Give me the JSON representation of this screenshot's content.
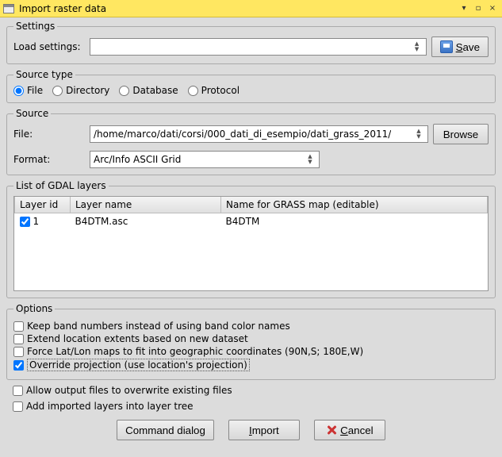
{
  "window": {
    "title": "Import raster data"
  },
  "settings": {
    "legend": "Settings",
    "load_label": "Load settings:",
    "save_label": "Save"
  },
  "source_type": {
    "legend": "Source type",
    "options": [
      "File",
      "Directory",
      "Database",
      "Protocol"
    ],
    "selected": "File"
  },
  "source": {
    "legend": "Source",
    "file_label": "File:",
    "file_value": "/home/marco/dati/corsi/000_dati_di_esempio/dati_grass_2011/",
    "browse_label": "Browse",
    "format_label": "Format:",
    "format_value": "Arc/Info ASCII Grid"
  },
  "layers": {
    "legend": "List of GDAL layers",
    "columns": [
      "Layer id",
      "Layer name",
      "Name for GRASS map (editable)"
    ],
    "rows": [
      {
        "checked": true,
        "id": "1",
        "name": "B4DTM.asc",
        "grass_name": "B4DTM"
      }
    ]
  },
  "options": {
    "legend": "Options",
    "keep_band": {
      "label": "Keep band numbers instead of using band color names",
      "checked": false
    },
    "extend_loc": {
      "label": "Extend location extents based on new dataset",
      "checked": false
    },
    "force_latlon": {
      "label": "Force Lat/Lon maps to fit into geographic coordinates (90N,S; 180E,W)",
      "checked": false
    },
    "override_proj": {
      "label": "Override projection (use location's projection)",
      "checked": true
    }
  },
  "extra": {
    "allow_overwrite": {
      "label": "Allow output files to overwrite existing files",
      "checked": false
    },
    "add_to_tree": {
      "label": "Add imported layers into layer tree",
      "checked": false
    }
  },
  "buttons": {
    "command_dialog": "Command dialog",
    "import": "Import",
    "cancel": "Cancel"
  }
}
